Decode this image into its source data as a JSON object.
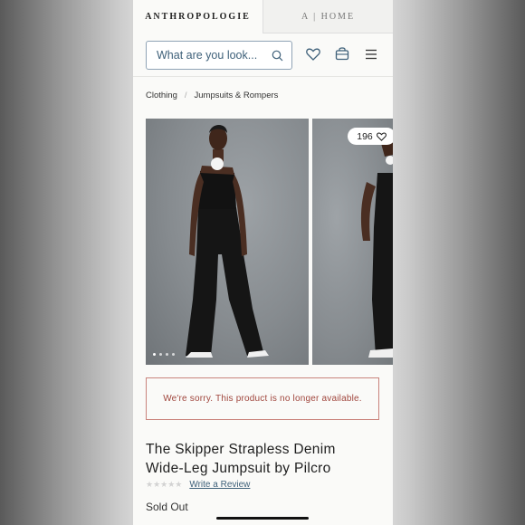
{
  "brand_tabs": [
    {
      "label": "ANTHROPOLOGIE"
    },
    {
      "label": "A | HOME"
    }
  ],
  "search": {
    "placeholder": "What are you look..."
  },
  "header_icons": [
    "heart-icon",
    "bag-icon",
    "menu-icon"
  ],
  "breadcrumb": {
    "items": [
      "Clothing",
      "Jumpsuits & Rompers"
    ],
    "separator": "/"
  },
  "gallery": {
    "favorite_count": "196",
    "dots_total": 4,
    "dot_active_index": 0
  },
  "notice": {
    "text": "We're sorry. This product is no longer available."
  },
  "product": {
    "title_line1": "The Skipper Strapless Denim",
    "title_line2": "Wide-Leg Jumpsuit by Pilcro",
    "rating_stars": "★★★★★",
    "rating_value": 0,
    "review_link": "Write a Review",
    "status": "Sold Out"
  },
  "colors": {
    "accent_blue": "#3e6079",
    "error_red": "#a0463d",
    "error_border": "#c9837c"
  }
}
